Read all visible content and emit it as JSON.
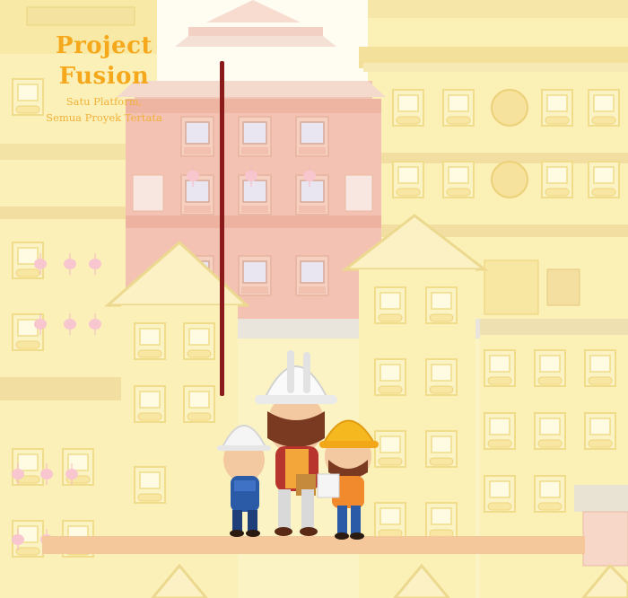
{
  "brand": {
    "title_line1": "Project",
    "title_line2": "Fusion",
    "tagline_line1": "Satu Platform,",
    "tagline_line2": "Semua Proyek Tertata",
    "accent_color": "#f6a81c"
  },
  "scene": {
    "description_icons": [
      "building-icon",
      "pagoda-icon",
      "worker-icon",
      "hardhat-icon",
      "lantern-icon"
    ]
  }
}
